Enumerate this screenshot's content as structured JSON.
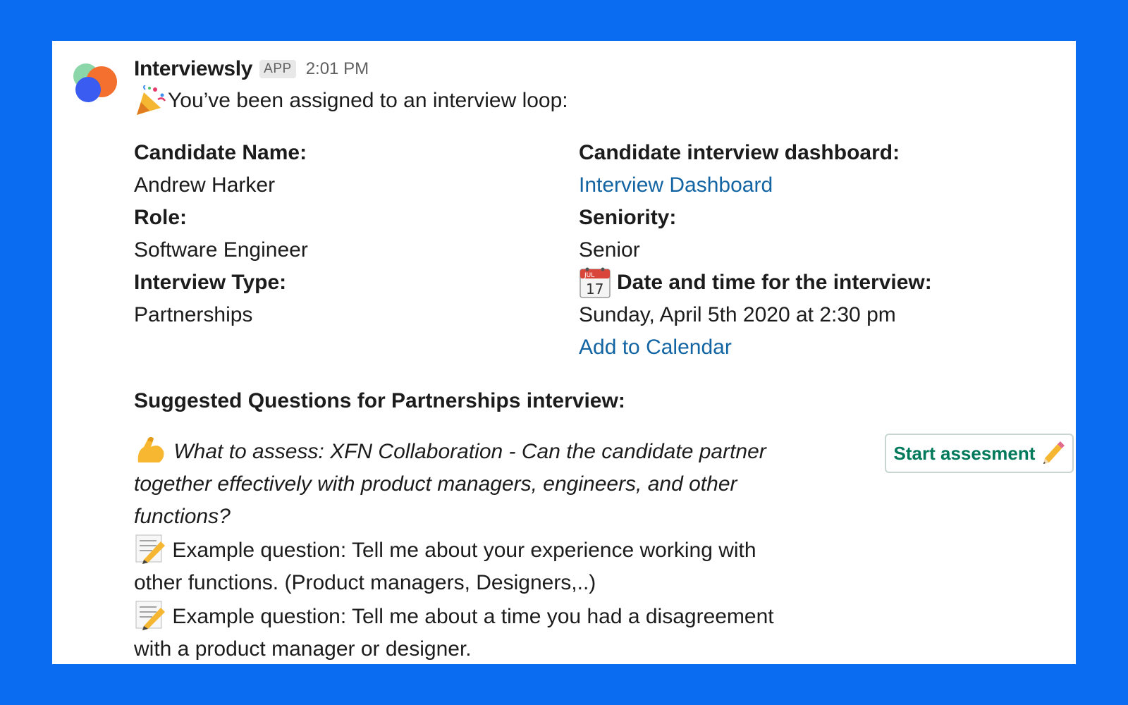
{
  "message": {
    "sender": "Interviewsly",
    "badge": "APP",
    "time": "2:01 PM",
    "intro": "You’ve been assigned to an interview loop:"
  },
  "fields": {
    "candidate_name_label": "Candidate Name:",
    "candidate_name": "Andrew Harker",
    "role_label": "Role:",
    "role": "Software Engineer",
    "interview_type_label": "Interview Type:",
    "interview_type": "Partnerships",
    "dashboard_label": "Candidate interview dashboard:",
    "dashboard_link": "Interview Dashboard",
    "seniority_label": "Seniority:",
    "seniority": "Senior",
    "calendar_icon_day": "17",
    "calendar_icon_month": "JUL",
    "date_label": "Date and time for the interview:",
    "date": "Sunday, April 5th 2020 at 2:30 pm",
    "add_calendar": "Add to Calendar"
  },
  "questions": {
    "title": "Suggested Questions for Partnerships interview:",
    "assess": "What to assess:  XFN Collaboration - Can the candidate partner together effectively with product managers, engineers, and other functions?",
    "example1": "Example question: Tell me about your experience working with other functions. (Product managers, Designers,..)",
    "example2": "Example question: Tell me about a time you had a disagreement with a product manager or designer.",
    "button": "Start assesment"
  },
  "icons": {
    "avatar": "interviewsly-logo-icon",
    "party": "party-popper-icon",
    "calendar": "calendar-icon",
    "muscle": "flexed-biceps-icon",
    "memo": "memo-icon",
    "pencil": "pencil-icon"
  },
  "colors": {
    "background": "#0a6cf0",
    "link": "#1264a3",
    "button_text": "#007a5a"
  }
}
